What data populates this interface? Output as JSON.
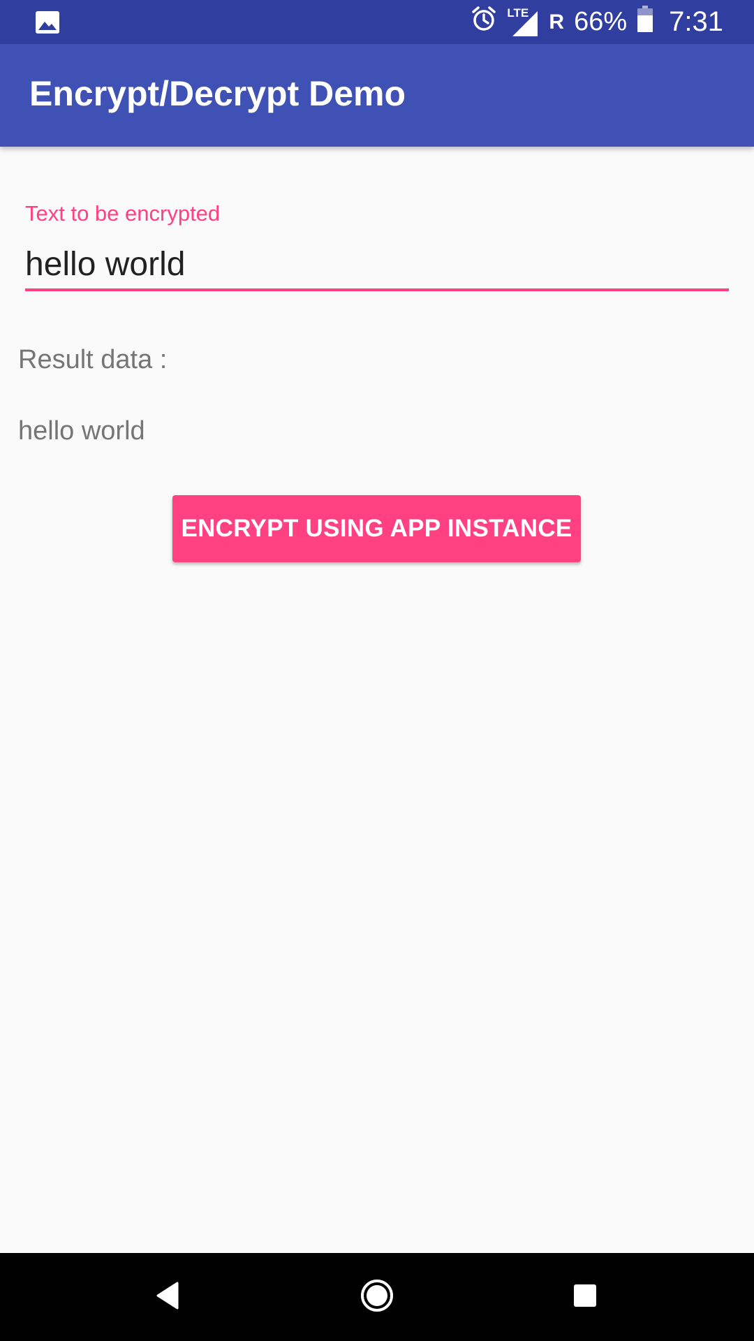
{
  "status_bar": {
    "left_icon": "image-icon",
    "alarm_icon": "alarm-clock-icon",
    "network_label": "LTE",
    "roaming_label": "R",
    "battery_percent": "66%",
    "battery_icon": "battery-icon",
    "time": "7:31",
    "background_color": "#303f9f"
  },
  "app_bar": {
    "title": "Encrypt/Decrypt Demo",
    "background_color": "#3f51b5"
  },
  "form": {
    "input_label": "Text to be encrypted",
    "input_value": "hello world",
    "accent_color": "#ff4081"
  },
  "result": {
    "label": "Result data :",
    "value": "hello world"
  },
  "actions": {
    "encrypt_button_label": "ENCRYPT USING APP INSTANCE"
  },
  "nav_bar": {
    "back_icon": "back-triangle-icon",
    "home_icon": "home-circle-icon",
    "recents_icon": "recents-square-icon"
  }
}
